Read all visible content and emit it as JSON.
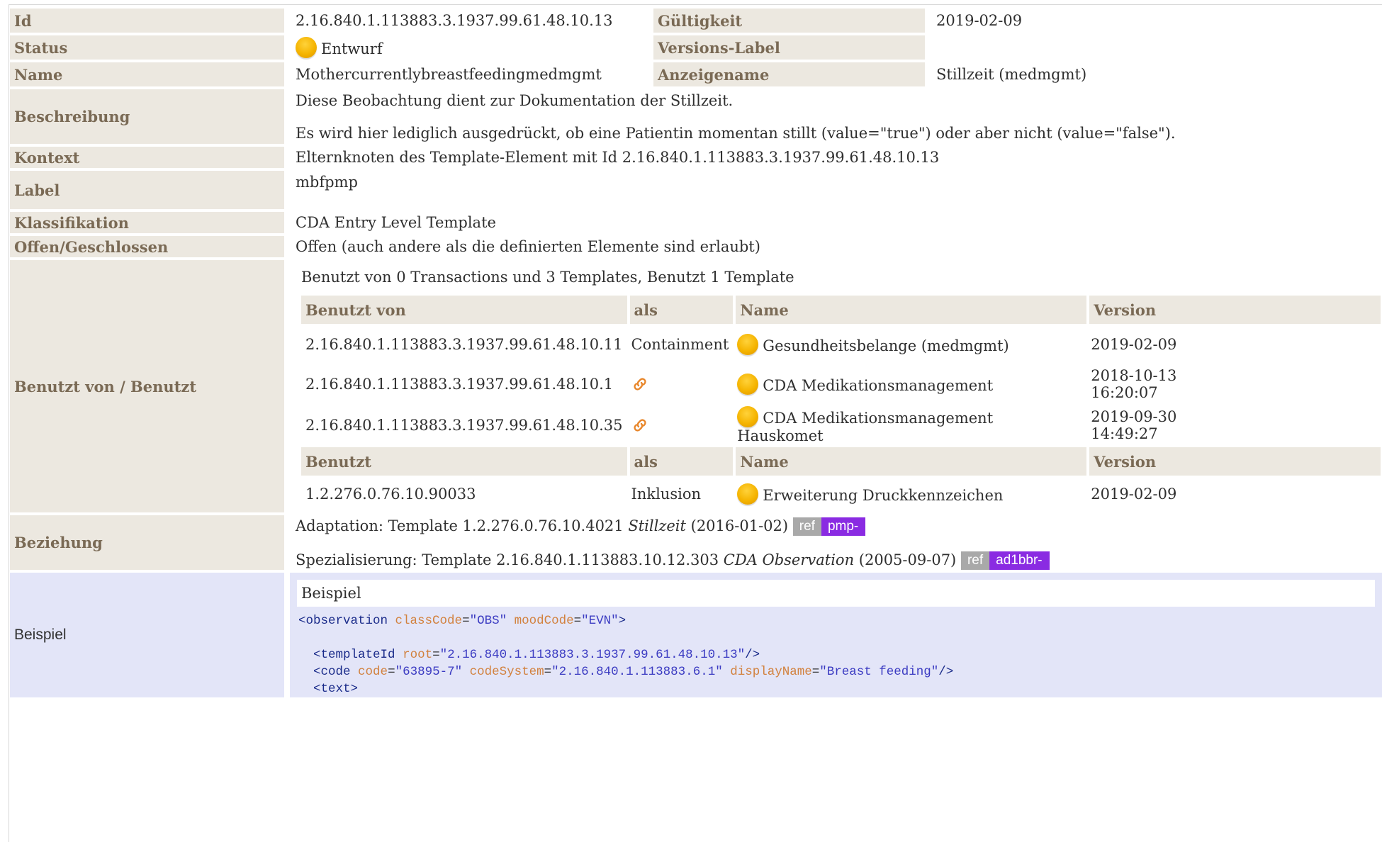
{
  "rows": {
    "id": {
      "label": "Id",
      "value": "2.16.840.1.113883.3.1937.99.61.48.10.13",
      "label2": "Gültigkeit",
      "value2": "2019-02-09"
    },
    "status": {
      "label": "Status",
      "value": "Entwurf",
      "label2": "Versions-Label",
      "value2": ""
    },
    "name": {
      "label": "Name",
      "value": "Mothercurrentlybreastfeedingmedmgmt",
      "label2": "Anzeigename",
      "value2": "Stillzeit (medmgmt)"
    },
    "beschreibung": {
      "label": "Beschreibung",
      "line1": "Diese Beobachtung dient zur Dokumentation der Stillzeit.",
      "line2": "Es wird hier lediglich ausgedrückt, ob eine Patientin momentan stillt (value=\"true\") oder aber nicht (value=\"false\")."
    },
    "kontext": {
      "label": "Kontext",
      "value": "Elternknoten des Template-Element mit Id 2.16.840.1.113883.3.1937.99.61.48.10.13"
    },
    "labelrow": {
      "label": "Label",
      "value": "mbfpmp"
    },
    "klassifikation": {
      "label": "Klassifikation",
      "value": "CDA Entry Level Template"
    },
    "offen": {
      "label": "Offen/Geschlossen",
      "value": "Offen (auch andere als die definierten Elemente sind erlaubt)"
    },
    "benutzt": {
      "label": "Benutzt von / Benutzt",
      "summary": "Benutzt von 0 Transactions und 3 Templates, Benutzt 1 Template",
      "head_used_by": {
        "c1": "Benutzt von",
        "c2": "als",
        "c3": "Name",
        "c4": "Version"
      },
      "used_by": [
        {
          "id": "2.16.840.1.113883.3.1937.99.61.48.10.11",
          "as": "Containment",
          "name": "Gesundheitsbelange (medmgmt)",
          "version": "2019-02-09"
        },
        {
          "id": "2.16.840.1.113883.3.1937.99.61.48.10.1",
          "as_icon": "link-icon",
          "name": "CDA Medikationsmanagement",
          "version": "2018-10-13",
          "version_time": "16:20:07"
        },
        {
          "id": "2.16.840.1.113883.3.1937.99.61.48.10.35",
          "as_icon": "link-icon",
          "name": "CDA Medikationsmanagement Hauskomet",
          "version": "2019-09-30",
          "version_time": "14:49:27"
        }
      ],
      "head_uses": {
        "c1": "Benutzt",
        "c2": "als",
        "c3": "Name",
        "c4": "Version"
      },
      "uses": [
        {
          "id": "1.2.276.0.76.10.90033",
          "as": "Inklusion",
          "name": "Erweiterung Druckkennzeichen",
          "version": "2019-02-09"
        }
      ]
    },
    "beziehung": {
      "label": "Beziehung",
      "line1": {
        "prefix": "Adaptation: Template 1.2.276.0.76.10.4021 ",
        "name": "Stillzeit",
        "suffix": " (2016-01-02) ",
        "ref": "ref",
        "badge": "pmp-"
      },
      "line2": {
        "prefix": "Spezialisierung: Template 2.16.840.1.113883.10.12.303 ",
        "name": "CDA Observation",
        "suffix": " (2005-09-07) ",
        "ref": "ref",
        "badge": "ad1bbr-"
      }
    },
    "beispiel": {
      "label": "Beispiel",
      "title": "Beispiel"
    }
  },
  "colors": {
    "label_bg": "#ece8e0",
    "label_fg": "#7a6a55",
    "example_bg": "#e3e5f8",
    "badge_ref": "#a9a9a9",
    "badge_prefix": "#8a2be2",
    "status_dot": "#f5b400"
  },
  "icons": {
    "status": "status-draft-dot-icon",
    "link": "link-icon"
  }
}
